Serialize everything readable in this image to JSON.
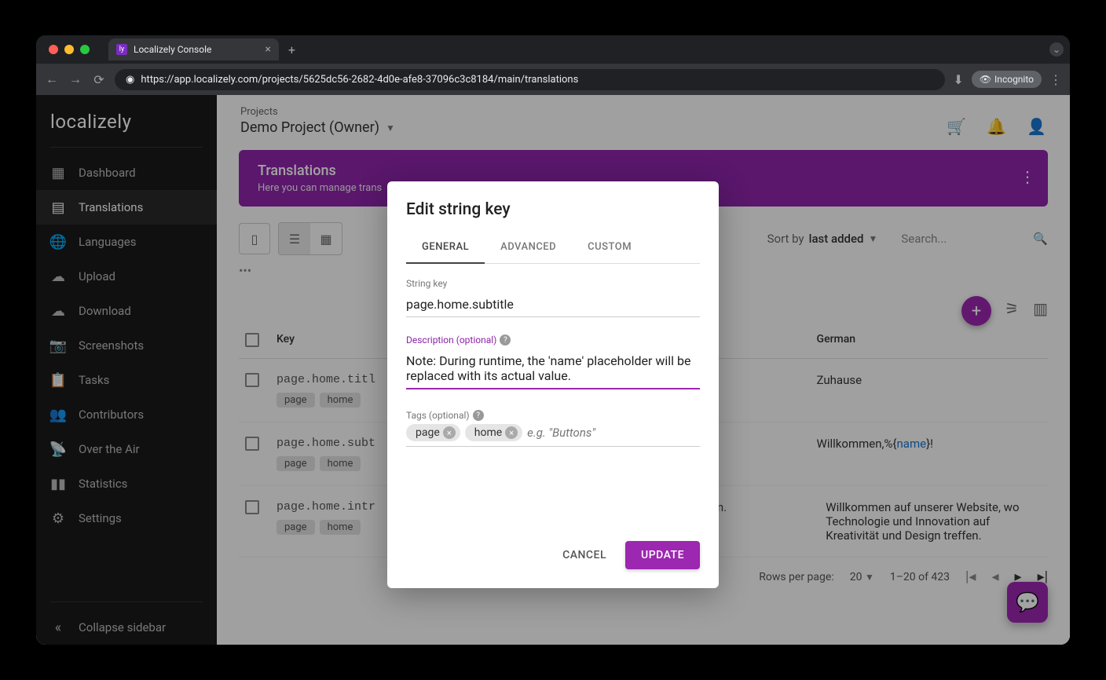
{
  "browser": {
    "tab_title": "Localizely Console",
    "url": "https://app.localizely.com/projects/5625dc56-2682-4d0e-afe8-37096c3c8184/main/translations",
    "incognito": "Incognito"
  },
  "logo": "localizely",
  "sidebar": {
    "items": [
      {
        "label": "Dashboard"
      },
      {
        "label": "Translations"
      },
      {
        "label": "Languages"
      },
      {
        "label": "Upload"
      },
      {
        "label": "Download"
      },
      {
        "label": "Screenshots"
      },
      {
        "label": "Tasks"
      },
      {
        "label": "Contributors"
      },
      {
        "label": "Over the Air"
      },
      {
        "label": "Statistics"
      },
      {
        "label": "Settings"
      }
    ],
    "collapse": "Collapse sidebar"
  },
  "header": {
    "crumb": "Projects",
    "project": "Demo Project (Owner)"
  },
  "banner": {
    "title": "Translations",
    "subtitle": "Here you can manage trans"
  },
  "sort": {
    "prefix": "Sort by ",
    "value": "last added"
  },
  "search_placeholder": "Search...",
  "columns": {
    "key": "Key",
    "german": "German"
  },
  "rows": [
    {
      "key": "page.home.titl",
      "tags": [
        "page",
        "home"
      ],
      "de": "Zuhause"
    },
    {
      "key": "page.home.subt",
      "tags": [
        "page",
        "home"
      ],
      "de_pre": "Willkommen,%{",
      "de_ph": "name",
      "de_post": "}!"
    },
    {
      "key": "page.home.intr",
      "tags": [
        "page",
        "home"
      ],
      "en": "creativity and design.",
      "de": "Willkommen auf unserer Website, wo Technologie und Innovation auf Kreativität und Design treffen."
    }
  ],
  "pagination": {
    "rows_label": "Rows per page:",
    "rows_value": "20",
    "range": "1–20 of 423"
  },
  "dialog": {
    "title": "Edit string key",
    "tabs": [
      "GENERAL",
      "ADVANCED",
      "CUSTOM"
    ],
    "string_key_label": "String key",
    "string_key_value": "page.home.subtitle",
    "desc_label": "Description (optional)",
    "desc_value": "Note: During runtime, the 'name' placeholder will be replaced with its actual value.",
    "tags_label": "Tags (optional)",
    "tags": [
      "page",
      "home"
    ],
    "tags_placeholder": "e.g. \"Buttons\"",
    "cancel": "CANCEL",
    "update": "UPDATE"
  }
}
